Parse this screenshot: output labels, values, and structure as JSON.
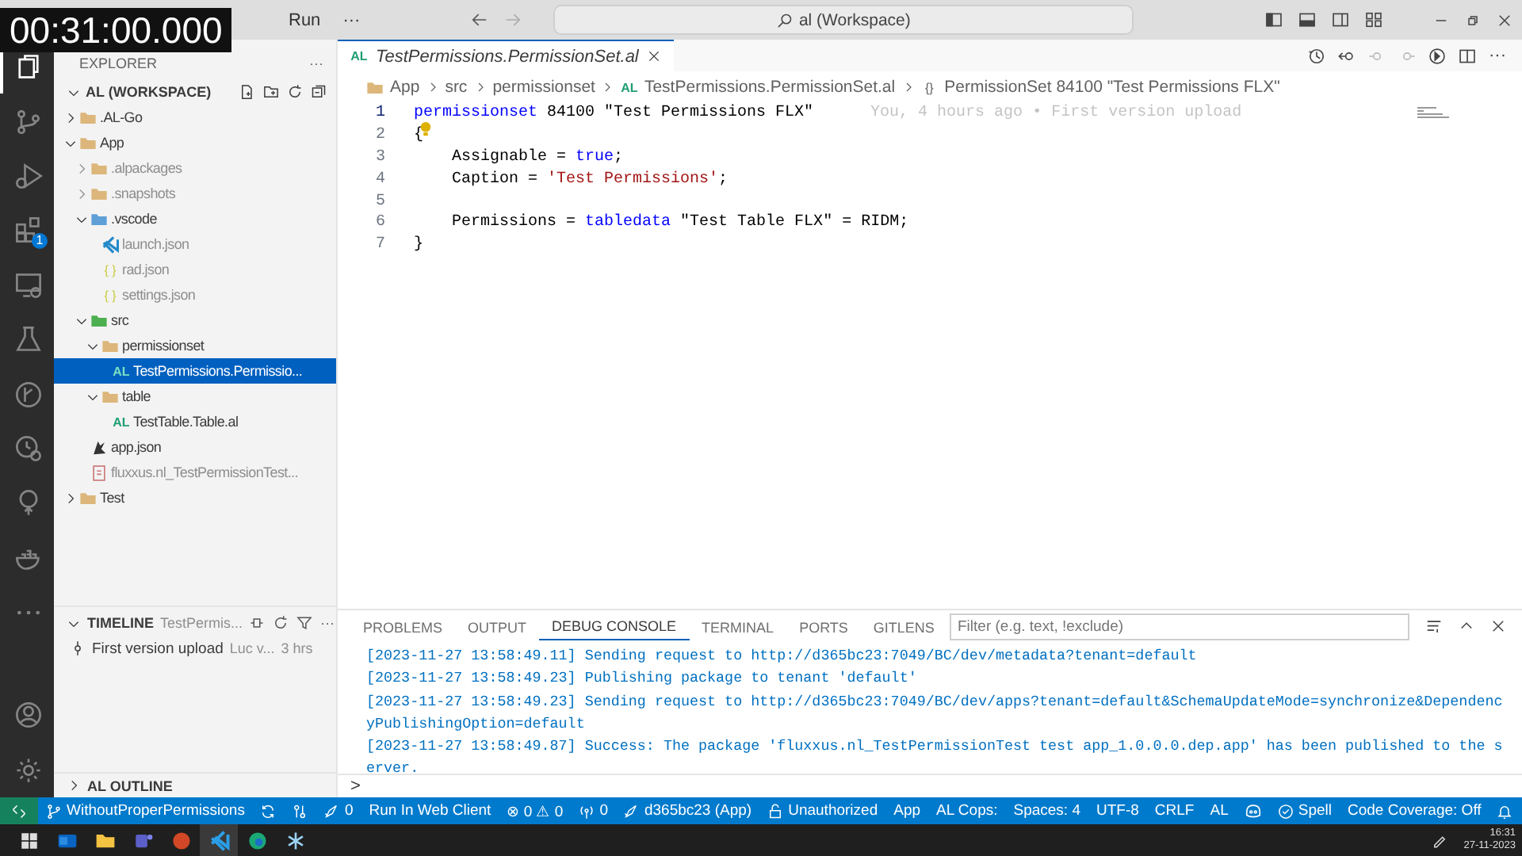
{
  "overlay": {
    "timestamp": "00:31:00.000"
  },
  "titlebar": {
    "menu": [
      "Run",
      "···"
    ],
    "search": "al (Workspace)"
  },
  "activity_bar": {
    "top": [
      {
        "selected": true
      },
      {
        "selected": false
      },
      {
        "selected": false
      },
      {
        "selected": false,
        "badge": "1"
      },
      {
        "selected": false
      },
      {
        "selected": false
      },
      {
        "selected": false
      },
      {
        "selected": false
      },
      {
        "selected": false
      },
      {
        "selected": false
      },
      {
        "selected": false
      }
    ]
  },
  "sidebar": {
    "title": "EXPLORER",
    "more": "···",
    "workspace": "AL (WORKSPACE)",
    "tree": [
      {
        "label": ".AL-Go",
        "kind": "folder",
        "expanded": false,
        "selected": false,
        "dimmed": false
      },
      {
        "label": "App",
        "kind": "folder",
        "expanded": true,
        "selected": false,
        "dimmed": false,
        "children": [
          {
            "label": ".alpackages",
            "kind": "folder",
            "expanded": false,
            "selected": false,
            "dimmed": true
          },
          {
            "label": ".snapshots",
            "kind": "folder",
            "expanded": false,
            "selected": false,
            "dimmed": true
          },
          {
            "label": ".vscode",
            "kind": "vsfolder",
            "expanded": true,
            "selected": false,
            "dimmed": false,
            "children": [
              {
                "label": "launch.json",
                "kind": "launch",
                "selected": false,
                "dimmed": true
              },
              {
                "label": "rad.json",
                "kind": "glyph",
                "glyph": "{ }",
                "selected": false,
                "dimmed": true
              },
              {
                "label": "settings.json",
                "kind": "glyph",
                "glyph": "{ }",
                "selected": false,
                "dimmed": true
              }
            ]
          },
          {
            "label": "src",
            "kind": "srcfolder",
            "expanded": true,
            "selected": false,
            "dimmed": false,
            "children": [
              {
                "label": "permissionset",
                "kind": "folder",
                "expanded": true,
                "selected": false,
                "dimmed": false,
                "children": [
                  {
                    "label": "TestPermissions.Permissio...",
                    "kind": "glyph",
                    "glyph": "AL",
                    "selected": true,
                    "dimmed": false
                  }
                ]
              },
              {
                "label": "table",
                "kind": "folder",
                "expanded": true,
                "selected": false,
                "dimmed": false,
                "children": [
                  {
                    "label": "TestTable.Table.al",
                    "kind": "glyph",
                    "glyph": "AL",
                    "selected": false,
                    "dimmed": false
                  }
                ]
              }
            ]
          },
          {
            "label": "app.json",
            "kind": "manifest",
            "selected": false,
            "dimmed": false
          },
          {
            "label": "fluxxus.nl_TestPermissionTest...",
            "kind": "package",
            "selected": false,
            "dimmed": true
          }
        ]
      },
      {
        "label": "Test",
        "kind": "folder",
        "expanded": false,
        "selected": false,
        "dimmed": false
      }
    ],
    "timeline": {
      "title": "TIMELINE",
      "subtitle": "TestPermis...",
      "more": "···",
      "items": [
        {
          "label": "First version upload",
          "author": "Luc v...",
          "time": "3 hrs"
        }
      ]
    },
    "outline": {
      "title": "AL OUTLINE"
    }
  },
  "editor": {
    "tab": {
      "glyph": "AL",
      "label": "TestPermissions.PermissionSet.al"
    },
    "breadcrumbs": [
      {
        "label": "App",
        "kind": "folder"
      },
      {
        "label": "src"
      },
      {
        "label": "permissionset"
      },
      {
        "label": "TestPermissions.PermissionSet.al",
        "glyph": "AL"
      },
      {
        "label": "PermissionSet 84100 \"Test Permissions FLX\"",
        "glyph": "{}"
      }
    ],
    "lines": [
      {
        "number": "1",
        "tokens": [
          {
            "kind": "keyword",
            "text": "permissionset"
          },
          {
            "kind": "plain",
            "text": " 84100 \"Test Permissions FLX\""
          }
        ],
        "blame": "You, 4 hours ago • First version upload"
      },
      {
        "number": "2",
        "tokens": [
          {
            "kind": "plain",
            "text": "{"
          }
        ],
        "lightbulb": true
      },
      {
        "number": "3",
        "tokens": [
          {
            "kind": "plain",
            "text": "    Assignable = "
          },
          {
            "kind": "keyword",
            "text": "true"
          },
          {
            "kind": "plain",
            "text": ";"
          }
        ]
      },
      {
        "number": "4",
        "tokens": [
          {
            "kind": "plain",
            "text": "    Caption = "
          },
          {
            "kind": "string",
            "text": "'Test Permissions'"
          },
          {
            "kind": "plain",
            "text": ";"
          }
        ]
      },
      {
        "number": "5"
      },
      {
        "number": "6",
        "tokens": [
          {
            "kind": "plain",
            "text": "    Permissions = "
          },
          {
            "kind": "keyword",
            "text": "tabledata"
          },
          {
            "kind": "plain",
            "text": " \"Test Table FLX\" = RIDM;"
          }
        ]
      },
      {
        "number": "7",
        "tokens": [
          {
            "kind": "plain",
            "text": "}"
          }
        ]
      }
    ]
  },
  "panel": {
    "tabs": [
      {
        "label": "PROBLEMS",
        "selected": false
      },
      {
        "label": "OUTPUT",
        "selected": false
      },
      {
        "label": "DEBUG CONSOLE",
        "selected": true
      },
      {
        "label": "TERMINAL",
        "selected": false
      },
      {
        "label": "PORTS",
        "selected": false
      },
      {
        "label": "GITLENS",
        "selected": false
      }
    ],
    "filter": {
      "placeholder": "Filter (e.g. text, !exclude)"
    },
    "log": [
      "[2023-11-27 13:58:49.11] Sending request to http://d365bc23:7049/BC/dev/metadata?tenant=default",
      "[2023-11-27 13:58:49.23] Publishing package to tenant 'default'",
      "[2023-11-27 13:58:49.23] Sending request to http://d365bc23:7049/BC/dev/apps?tenant=default&SchemaUpdateMode=synchronize&DependencyPublishingOption=default",
      "[2023-11-27 13:58:49.87] Success: The package 'fluxxus.nl_TestPermissionTest test app_1.0.0.0.dep.app' has been published to the server."
    ],
    "prompt": ">"
  },
  "status_bar": {
    "left": [
      {
        "kind": "branch",
        "label": "WithoutProperPermissions"
      },
      {
        "kind": "sync"
      },
      {
        "kind": "graph"
      },
      {
        "kind": "deploy",
        "label": "0"
      },
      {
        "kind": "text",
        "label": "Run In Web Client"
      },
      {
        "kind": "text",
        "label": "⊗ 0 ⚠ 0"
      },
      {
        "kind": "radio",
        "label": "0"
      },
      {
        "kind": "deploy",
        "label": "d365bc23 (App)"
      },
      {
        "kind": "lock",
        "label": "Unauthorized"
      },
      {
        "kind": "text",
        "label": "App"
      },
      {
        "kind": "text",
        "label": "AL Cops:"
      }
    ],
    "right": [
      {
        "kind": "text",
        "label": "Spaces: 4"
      },
      {
        "kind": "text",
        "label": "UTF-8"
      },
      {
        "kind": "text",
        "label": "CRLF"
      },
      {
        "kind": "text",
        "label": "AL"
      },
      {
        "kind": "copilot"
      },
      {
        "kind": "check",
        "label": "Spell"
      },
      {
        "kind": "text",
        "label": "Code Coverage: Off"
      },
      {
        "kind": "bell"
      }
    ]
  },
  "taskbar": {
    "apps": [
      {
        "kind": "start",
        "selected": false
      },
      {
        "kind": "mail",
        "selected": false
      },
      {
        "kind": "files",
        "selected": false
      },
      {
        "kind": "chat",
        "selected": false
      },
      {
        "kind": "office",
        "selected": false
      },
      {
        "kind": "code",
        "selected": true
      },
      {
        "kind": "browser",
        "selected": false
      },
      {
        "kind": "flake",
        "selected": false
      }
    ],
    "time": "16:31",
    "date": "27-11-2023"
  }
}
